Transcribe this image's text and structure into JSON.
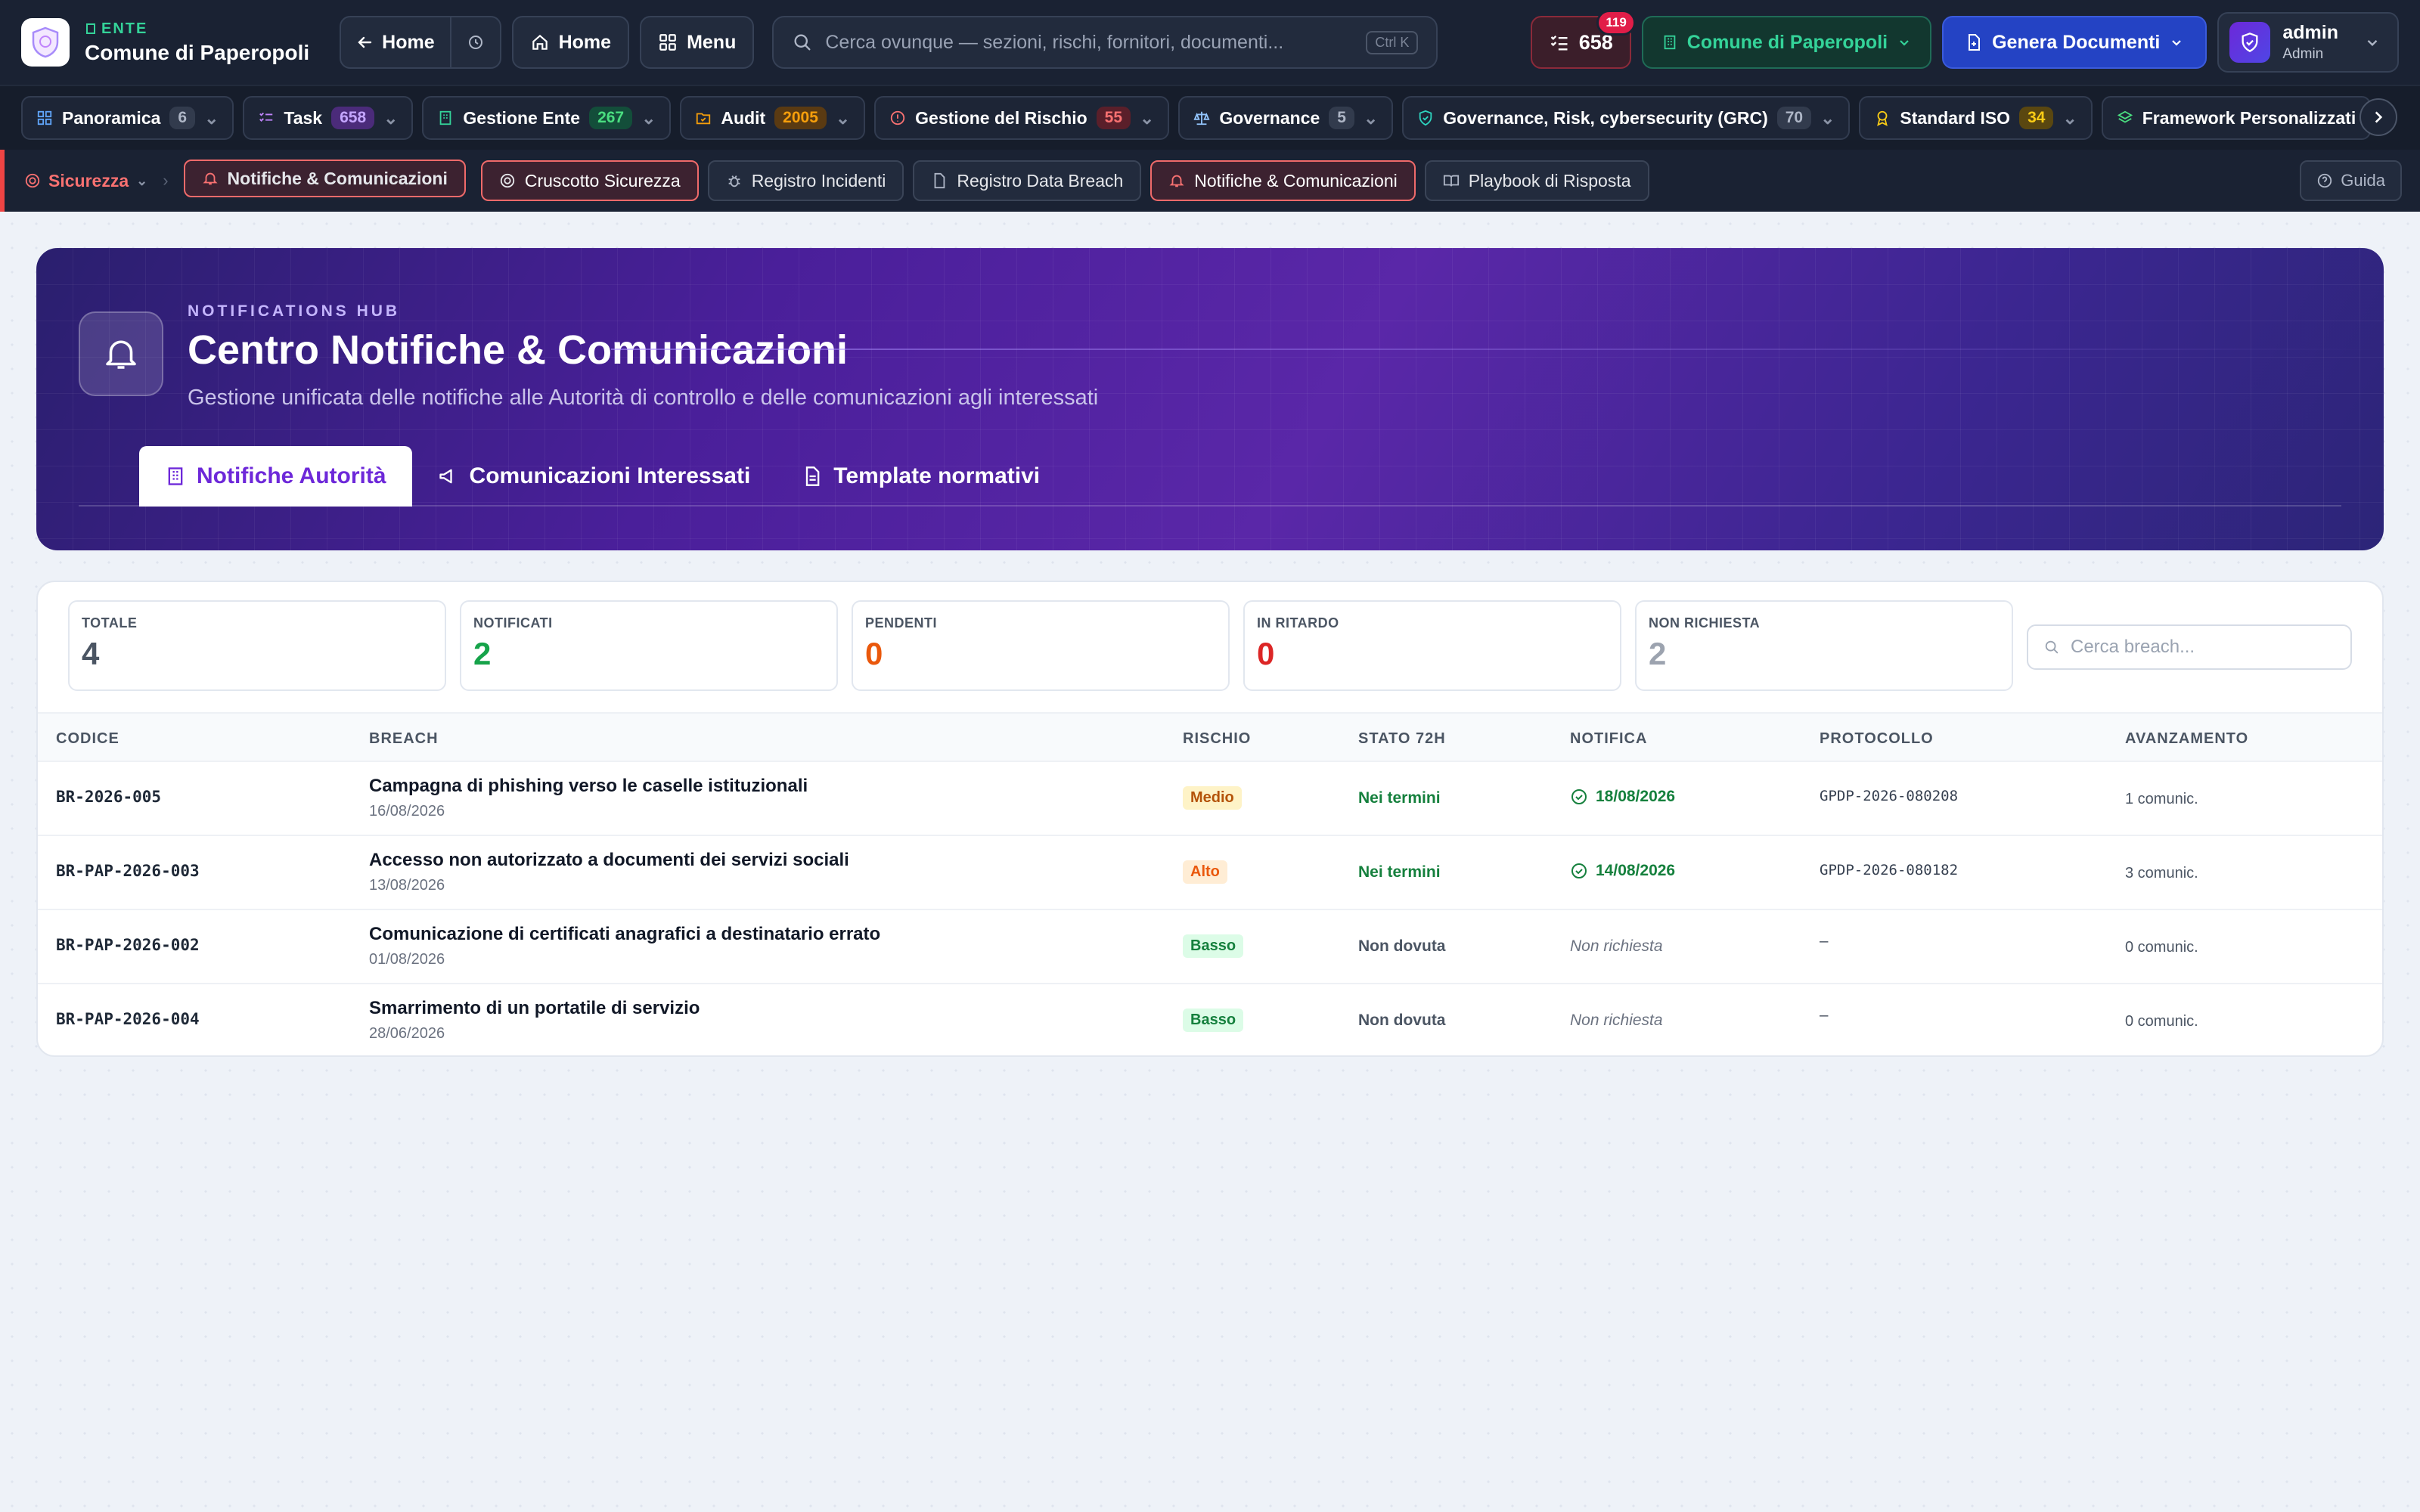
{
  "app": {
    "org_tag": "ENTE",
    "org_name": "Comune di Paperopoli"
  },
  "topbar": {
    "back_home": "Home",
    "home": "Home",
    "menu": "Menu",
    "search_placeholder": "Cerca ovunque — sezioni, rischi, fornitori, documenti...",
    "search_shortcut": "Ctrl K",
    "tasks_count": "658",
    "notifications_count": "119",
    "ente_selector": "Comune di Paperopoli",
    "generate_docs": "Genera Documenti",
    "user_name": "admin",
    "user_role": "Admin"
  },
  "modules": [
    {
      "label": "Panoramica",
      "count": "6",
      "color": "gray"
    },
    {
      "label": "Task",
      "count": "658",
      "color": "purple"
    },
    {
      "label": "Gestione Ente",
      "count": "267",
      "color": "green"
    },
    {
      "label": "Audit",
      "count": "2005",
      "color": "orange"
    },
    {
      "label": "Gestione del Rischio",
      "count": "55",
      "color": "red"
    },
    {
      "label": "Governance",
      "count": "5",
      "color": "gray"
    },
    {
      "label": "Governance, Risk, cybersecurity (GRC)",
      "count": "70",
      "color": "gray"
    },
    {
      "label": "Standard ISO",
      "count": "34",
      "color": "yellow"
    },
    {
      "label": "Framework Personalizzati",
      "count": "",
      "color": "gray"
    }
  ],
  "subnav": {
    "section": "Sicurezza",
    "current": "Notifiche & Comunicazioni",
    "items": [
      "Cruscotto Sicurezza",
      "Registro Incidenti",
      "Registro Data Breach",
      "Notifiche & Comunicazioni",
      "Playbook di Risposta"
    ],
    "help": "Guida"
  },
  "hero": {
    "eyebrow": "NOTIFICATIONS HUB",
    "title": "Centro Notifiche & Comunicazioni",
    "subtitle": "Gestione unificata delle notifiche alle Autorità di controllo e delle comunicazioni agli interessati",
    "tabs": [
      "Notifiche Autorità",
      "Comunicazioni Interessati",
      "Template normativi"
    ]
  },
  "stats": [
    {
      "label": "TOTALE",
      "value": "4",
      "color": "#4b5563"
    },
    {
      "label": "NOTIFICATI",
      "value": "2",
      "color": "#16a34a"
    },
    {
      "label": "PENDENTI",
      "value": "0",
      "color": "#ea580c"
    },
    {
      "label": "IN RITARDO",
      "value": "0",
      "color": "#dc2626"
    },
    {
      "label": "NON RICHIESTA",
      "value": "2",
      "color": "#9ca3af"
    }
  ],
  "table": {
    "search_placeholder": "Cerca breach...",
    "columns": [
      "CODICE",
      "BREACH",
      "RISCHIO",
      "STATO 72H",
      "NOTIFICA",
      "PROTOCOLLO",
      "AVANZAMENTO"
    ],
    "rows": [
      {
        "code": "BR-2026-005",
        "title": "Campagna di phishing verso le caselle istituzionali",
        "date": "16/08/2026",
        "risk": "Medio",
        "status": "Nei termini",
        "notification": "18/08/2026",
        "protocol": "GPDP-2026-080208",
        "progress": "1 comunic."
      },
      {
        "code": "BR-PAP-2026-003",
        "title": "Accesso non autorizzato a documenti dei servizi sociali",
        "date": "13/08/2026",
        "risk": "Alto",
        "status": "Nei termini",
        "notification": "14/08/2026",
        "protocol": "GPDP-2026-080182",
        "progress": "3 comunic."
      },
      {
        "code": "BR-PAP-2026-002",
        "title": "Comunicazione di certificati anagrafici a destinatario errato",
        "date": "01/08/2026",
        "risk": "Basso",
        "status": "Non dovuta",
        "notification": "Non richiesta",
        "protocol": "–",
        "progress": "0 comunic."
      },
      {
        "code": "BR-PAP-2026-004",
        "title": "Smarrimento di un portatile di servizio",
        "date": "28/06/2026",
        "risk": "Basso",
        "status": "Non dovuta",
        "notification": "Non richiesta",
        "protocol": "–",
        "progress": "0 comunic."
      }
    ]
  }
}
